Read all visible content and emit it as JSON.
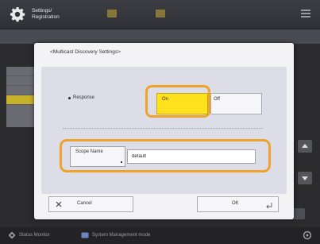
{
  "header": {
    "title_line1": "Settings/",
    "title_line2": "Registration",
    "shortcut1_label": "",
    "shortcut2_label": ""
  },
  "background": {
    "breadcrumb": "",
    "list_items": [
      "",
      "",
      "",
      ""
    ],
    "selected_index": 3,
    "page_count": ""
  },
  "dialog": {
    "title": "<Multicast Discovery Settings>",
    "response_label": "Response",
    "on_label": "On",
    "off_label": "Off",
    "selected": "On",
    "scope_name_button": "Scope Name",
    "scope_name_value": "default",
    "cancel_label": "Cancel",
    "ok_label": "OK"
  },
  "status_bar": {
    "status_monitor": "Status Monitor",
    "system_mode": "System Management mode"
  },
  "colors": {
    "highlight": "#f0a32b",
    "selected_button": "#ffe21e"
  }
}
